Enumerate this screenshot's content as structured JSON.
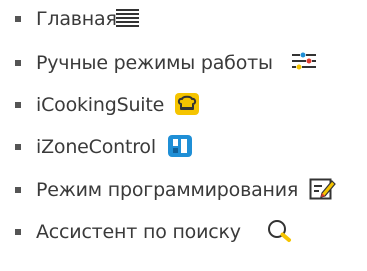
{
  "menu": {
    "items": [
      {
        "label": "Главная",
        "icon": "menu-lines-icon"
      },
      {
        "label": "Ручные режимы работы",
        "icon": "sliders-icon"
      },
      {
        "label": "iCookingSuite",
        "icon": "chef-hat-icon"
      },
      {
        "label": "iZoneControl",
        "icon": "zone-control-icon"
      },
      {
        "label": "Режим программирования",
        "icon": "edit-pen-icon"
      },
      {
        "label": "Ассистент по поиску",
        "icon": "search-icon"
      }
    ]
  },
  "colors": {
    "text": "#3a3a3a",
    "bullet": "#555555",
    "accent_yellow": "#f5c400",
    "accent_blue": "#1f8fd6",
    "accent_red": "#e03a2f"
  }
}
